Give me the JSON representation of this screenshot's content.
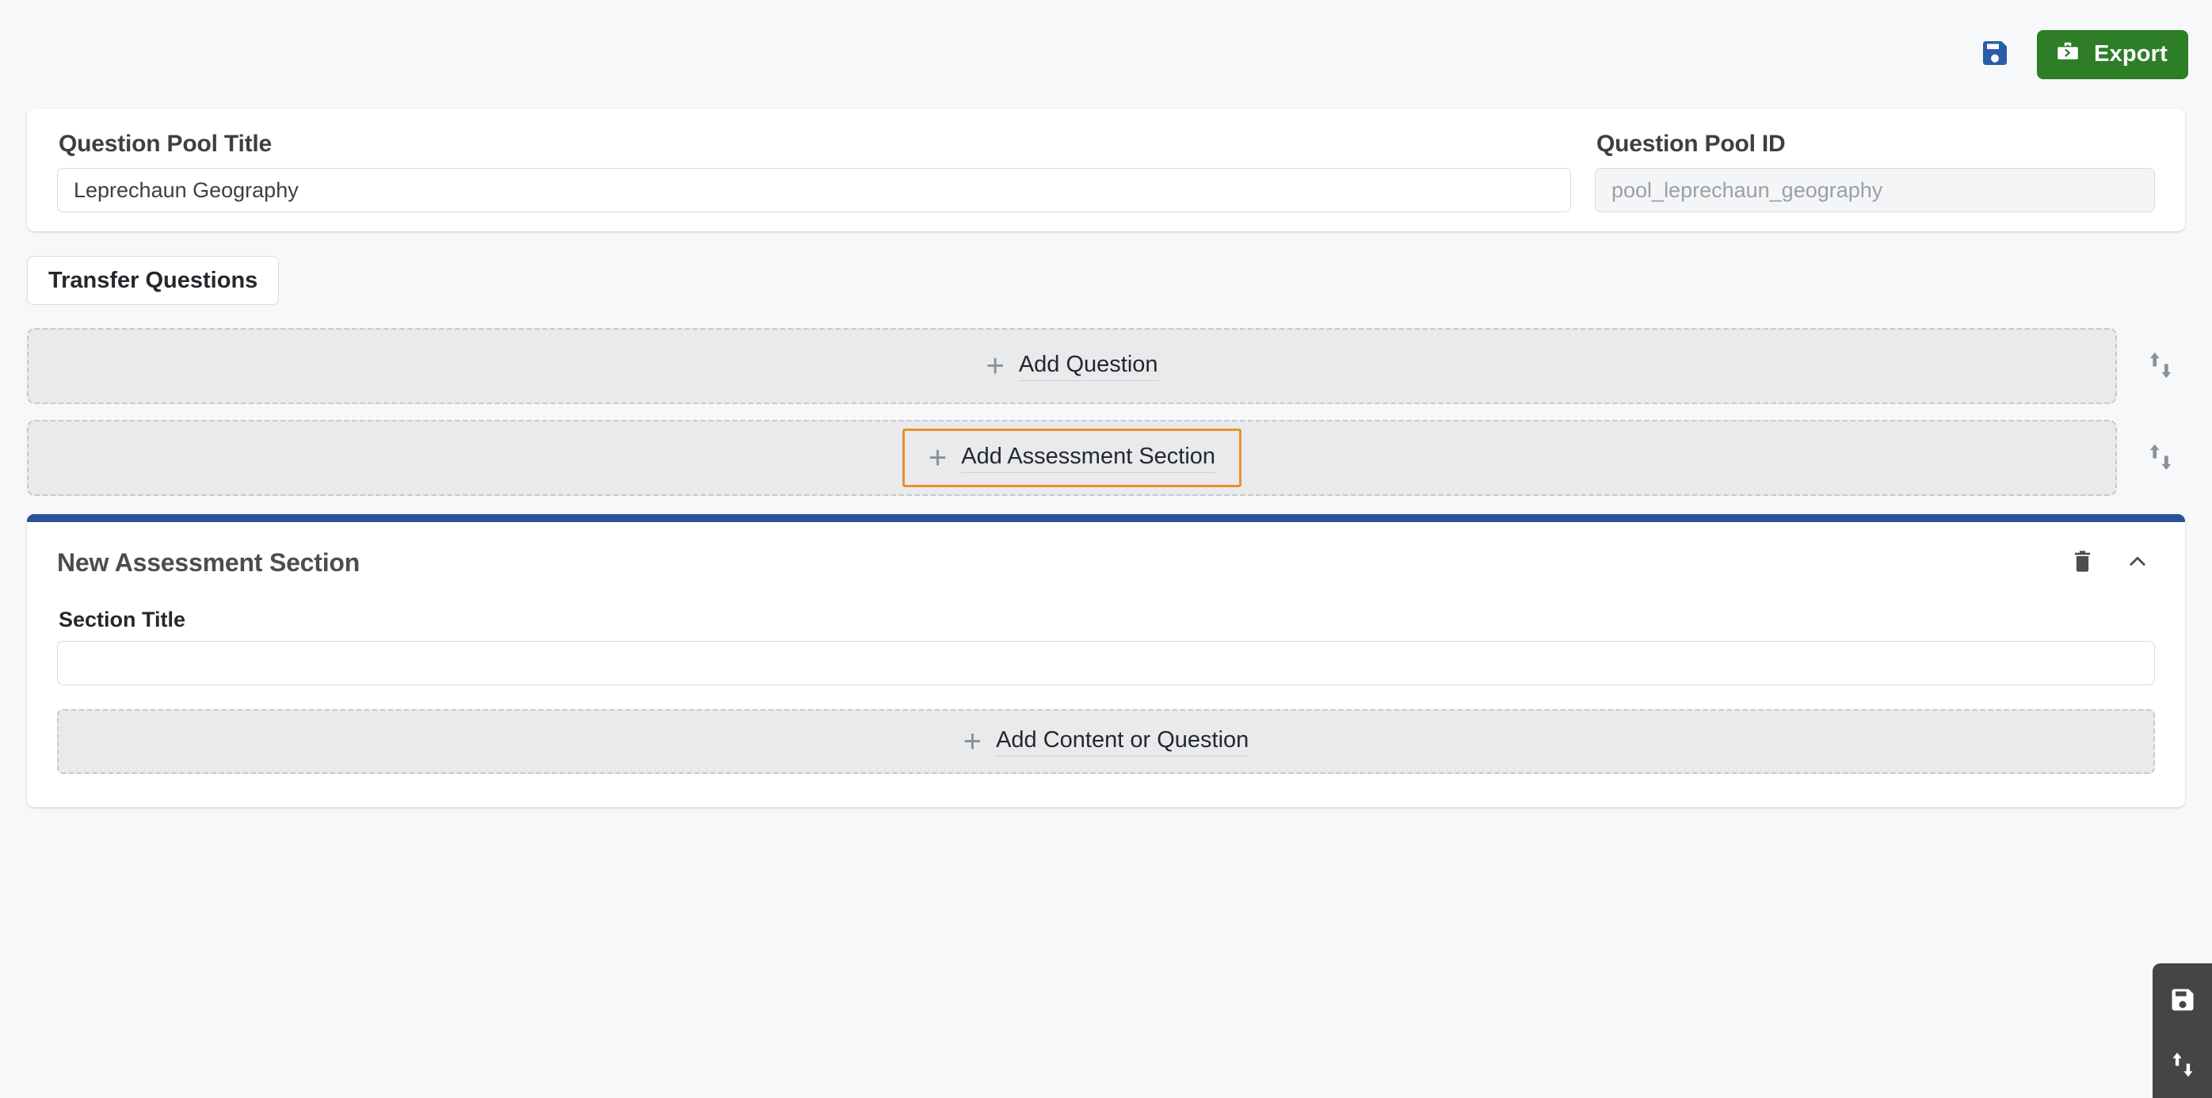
{
  "toolbar": {
    "save_icon": "save-floppy-icon",
    "export_label": "Export",
    "export_icon": "export-briefcase-icon",
    "export_color": "#2e7d27",
    "save_color": "#2a5caa"
  },
  "pool": {
    "title_label": "Question Pool Title",
    "title_value": "Leprechaun Geography",
    "id_label": "Question Pool ID",
    "id_value": "pool_leprechaun_geography"
  },
  "actions": {
    "transfer_label": "Transfer Questions"
  },
  "add_rows": [
    {
      "label": "Add Question",
      "plus": "+",
      "focused": false,
      "sort_icon": "sort-up-down-icon"
    },
    {
      "label": "Add Assessment Section",
      "plus": "+",
      "focused": true,
      "focus_color": "#e8912d",
      "sort_icon": "sort-up-down-icon"
    }
  ],
  "section": {
    "accent_color": "#2a5298",
    "heading": "New Assessment Section",
    "delete_icon": "trash-icon",
    "collapse_icon": "chevron-up-icon",
    "title_label": "Section Title",
    "title_value": "",
    "title_placeholder": "",
    "add_label": "Add Content or Question",
    "plus": "+"
  },
  "dock": {
    "save_icon": "save-floppy-icon",
    "sort_icon": "sort-up-down-icon",
    "background": "#454545"
  }
}
